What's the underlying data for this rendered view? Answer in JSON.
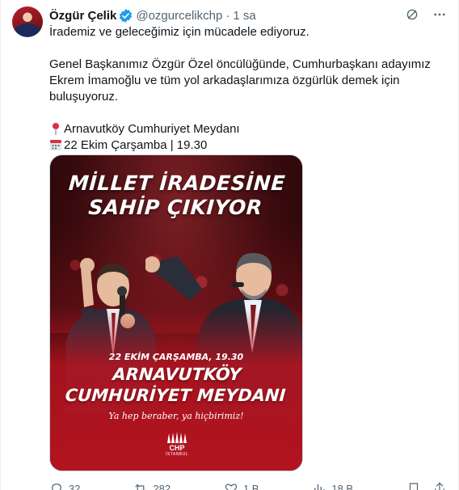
{
  "author": {
    "name": "Özgür Çelik",
    "handle": "@ozgurcelikchp",
    "separator": "·",
    "time": "1 sa",
    "verified_icon": "verified-badge-icon"
  },
  "body": {
    "line1": "İrademiz ve geleceğimiz için mücadele ediyoruz.",
    "line2": "Genel Başkanımız Özgür Özel öncülüğünde, Cumhurbaşkanı adayımız Ekrem İmamoğlu ve tüm yol arkadaşlarımıza özgürlük demek için buluşuyoruz.",
    "location": "Arnavutköy Cumhuriyet Meydanı",
    "datetime": "22 Ekim Çarşamba | 19.30"
  },
  "media": {
    "headline_line1": "MİLLET İRADESİNE",
    "headline_line2": "SAHİP ÇIKIYOR",
    "event_date": "22 EKİM ÇARŞAMBA, 19.30",
    "venue_line1": "ARNAVUTKÖY",
    "venue_line2": "CUMHURİYET MEYDANI",
    "slogan": "Ya hep beraber, ya hiçbirimiz!",
    "logo_text": "CHP",
    "logo_city": "İSTANBUL"
  },
  "actions": {
    "replies": "32",
    "reposts": "282",
    "likes": "1 B",
    "views": "18 B"
  },
  "colors": {
    "accent": "#1d9bf0",
    "muted": "#536471",
    "poster_red": "#b3141f"
  }
}
